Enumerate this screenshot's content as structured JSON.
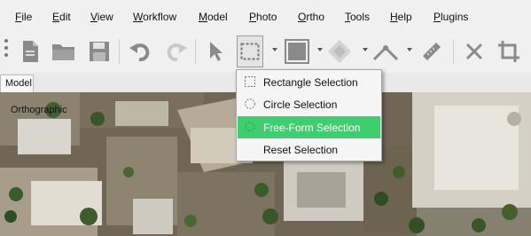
{
  "menu": [
    {
      "key": "file",
      "label": "File"
    },
    {
      "key": "edit",
      "label": "Edit"
    },
    {
      "key": "view",
      "label": "View"
    },
    {
      "key": "workflow",
      "label": "Workflow"
    },
    {
      "key": "model",
      "label": "Model"
    },
    {
      "key": "photo",
      "label": "Photo"
    },
    {
      "key": "ortho",
      "label": "Ortho"
    },
    {
      "key": "tools",
      "label": "Tools"
    },
    {
      "key": "help",
      "label": "Help"
    },
    {
      "key": "plugins",
      "label": "Plugins"
    }
  ],
  "toolbar": {
    "buttons": [
      "new-document-icon",
      "open-folder-icon",
      "save-icon",
      "undo-icon",
      "redo-icon",
      "navigation-cursor-icon",
      "selection-icon",
      "resize-region-icon",
      "rotate-region-icon",
      "ruler-icon",
      "measure-tape-icon",
      "delete-selection-icon",
      "crop-selection-icon"
    ],
    "active": "selection-icon"
  },
  "tabs": {
    "model": "Model"
  },
  "viewport": {
    "label": "Orthographic"
  },
  "selection_menu": {
    "items": [
      {
        "label": "Rectangle Selection",
        "icon": "rectangle-selection-icon",
        "highlighted": false
      },
      {
        "label": "Circle Selection",
        "icon": "circle-selection-icon",
        "highlighted": false
      },
      {
        "label": "Free-Form Selection",
        "icon": "free-form-selection-icon",
        "highlighted": true
      },
      {
        "label": "Reset Selection",
        "icon": "",
        "highlighted": false
      }
    ]
  },
  "colors": {
    "highlight": "#3fcd6f",
    "toolbar_bg": "#f0f0f0",
    "menu_bg": "#f5f5f5"
  }
}
